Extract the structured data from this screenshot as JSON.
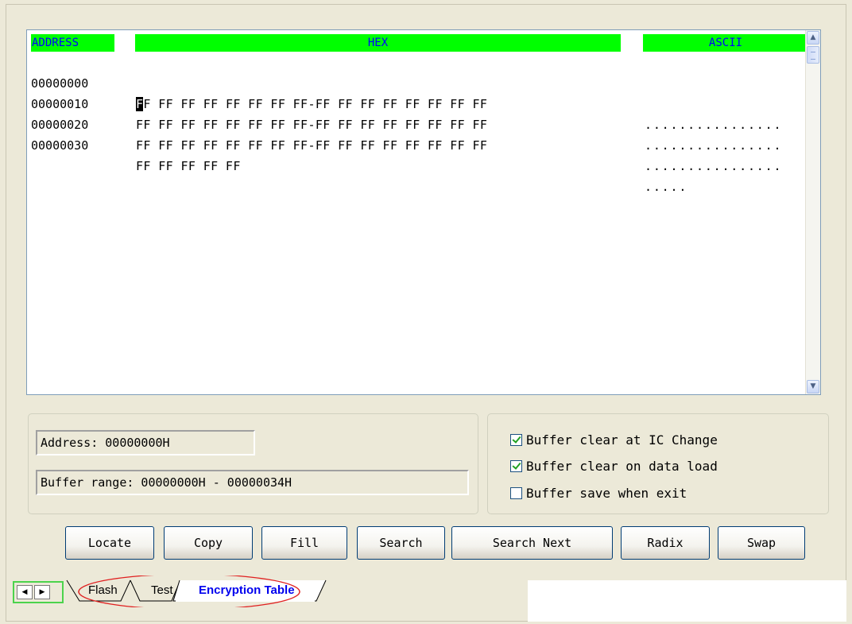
{
  "editor": {
    "headers": {
      "address": "ADDRESS",
      "hex": "HEX",
      "ascii": "ASCII"
    },
    "cursor_char": "F",
    "rows": [
      {
        "address": "00000000",
        "hex_rest": "F FF FF FF FF FF FF FF-FF FF FF FF FF FF FF FF",
        "ascii": "................"
      },
      {
        "address": "00000010",
        "hex": "FF FF FF FF FF FF FF FF-FF FF FF FF FF FF FF FF",
        "ascii": "................"
      },
      {
        "address": "00000020",
        "hex": "FF FF FF FF FF FF FF FF-FF FF FF FF FF FF FF FF",
        "ascii": "................"
      },
      {
        "address": "00000030",
        "hex": "FF FF FF FF FF",
        "ascii": "....."
      }
    ]
  },
  "info": {
    "address_field": "Address: 00000000H",
    "range_field": "Buffer range: 00000000H - 00000034H"
  },
  "options": [
    {
      "label": "Buffer clear at IC Change",
      "checked": true
    },
    {
      "label": "Buffer clear on data load",
      "checked": true
    },
    {
      "label": "Buffer save when exit",
      "checked": false
    }
  ],
  "buttons": [
    "Locate",
    "Copy",
    "Fill",
    "Search",
    "Search Next",
    "Radix",
    "Swap"
  ],
  "tabs": {
    "flash": "Flash",
    "test": "Test",
    "encryption": "Encryption Table",
    "active": "encryption"
  },
  "colors": {
    "header_bg": "#00ff00",
    "header_text": "#0000ff",
    "active_tab": "#0000ee",
    "highlight_ellipse": "#e02020"
  }
}
